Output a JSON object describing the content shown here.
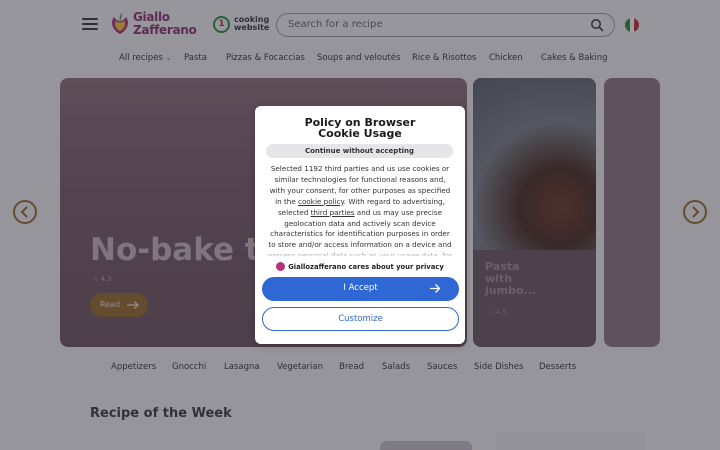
{
  "header": {
    "logo_line1": "Giallo",
    "logo_line2": "Zafferano",
    "cooking_badge_line1": "cooking",
    "cooking_badge_line2": "website",
    "search_placeholder": "Search for a recipe",
    "flag_icon": "italy-flag-icon"
  },
  "categories": [
    {
      "label": "All recipes"
    },
    {
      "label": "Pasta"
    },
    {
      "label": "Pizzas & Focaccias"
    },
    {
      "label": "Soups and veloutés"
    },
    {
      "label": "Rice & Risottos"
    },
    {
      "label": "Chicken"
    },
    {
      "label": "Cakes & Baking"
    }
  ],
  "carousel": {
    "hero_title": "No-bake ta",
    "hero_rating": "4.3",
    "read_label": "Read",
    "card2_title_line1": "Pasta",
    "card2_title_line2": "with",
    "card2_title_line3": "jumbo...",
    "card2_rating": "4.5"
  },
  "dishes": [
    {
      "label": "Appetizers"
    },
    {
      "label": "Gnocchi"
    },
    {
      "label": "Lasagna"
    },
    {
      "label": "Vegetarian"
    },
    {
      "label": "Bread"
    },
    {
      "label": "Salads"
    },
    {
      "label": "Sauces"
    },
    {
      "label": "Side Dishes"
    },
    {
      "label": "Desserts"
    }
  ],
  "section": {
    "recipe_of_week": "Recipe of the Week"
  },
  "cookie_modal": {
    "title_line1": "Policy on Browser",
    "title_line2": "Cookie Usage",
    "continue_label": "Continue without accepting",
    "body_part1": "Selected 1192 third parties and us use cookies or similar technologies for functional reasons and, with your consent, for other purposes as specified in the ",
    "cookie_policy_link": "cookie policy",
    "body_part2": ". With regard to advertising, selected ",
    "third_parties_link": "third parties",
    "body_part3": " and us may use precise geolocation data and actively scan device characteristics for identification purposes in order to store and/or access information on a device and process personal data such as your usage data, for the following",
    "cares_text": "Giallozafferano cares about your privacy",
    "accept_label": "I Accept",
    "customize_label": "Customize"
  },
  "colors": {
    "accent_blue": "#2f67d4",
    "brand_purple": "#8a2f6e",
    "read_orange": "#9a6a2a"
  }
}
